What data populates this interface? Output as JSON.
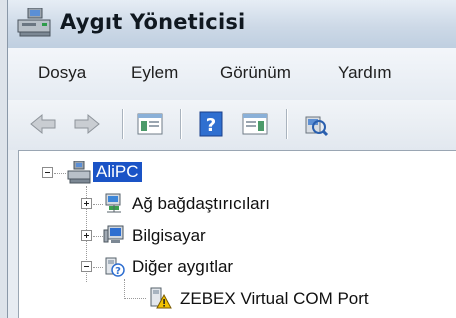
{
  "window": {
    "title": "Aygıt Yöneticisi"
  },
  "menu": {
    "items": [
      "Dosya",
      "Eylem",
      "Görünüm",
      "Yardım"
    ]
  },
  "toolbar": {
    "icons": [
      "back-arrow-icon",
      "forward-arrow-icon",
      "show-hide-console-tree-icon",
      "help-icon",
      "properties-pane-icon",
      "scan-hardware-icon"
    ]
  },
  "tree": {
    "root": {
      "label": "AliPC",
      "expanded": true,
      "selected": true
    },
    "nodes": [
      {
        "label": "Ağ bağdaştırıcıları",
        "expanded": false,
        "icon": "network-adapter-icon"
      },
      {
        "label": "Bilgisayar",
        "expanded": false,
        "icon": "computer-icon"
      },
      {
        "label": "Diğer aygıtlar",
        "expanded": true,
        "icon": "unknown-device-icon",
        "children": [
          {
            "label": "ZEBEX Virtual COM Port",
            "icon": "warning-device-icon"
          }
        ]
      }
    ]
  },
  "colors": {
    "selection": "#1a53c6",
    "warning": "#f2c200"
  }
}
